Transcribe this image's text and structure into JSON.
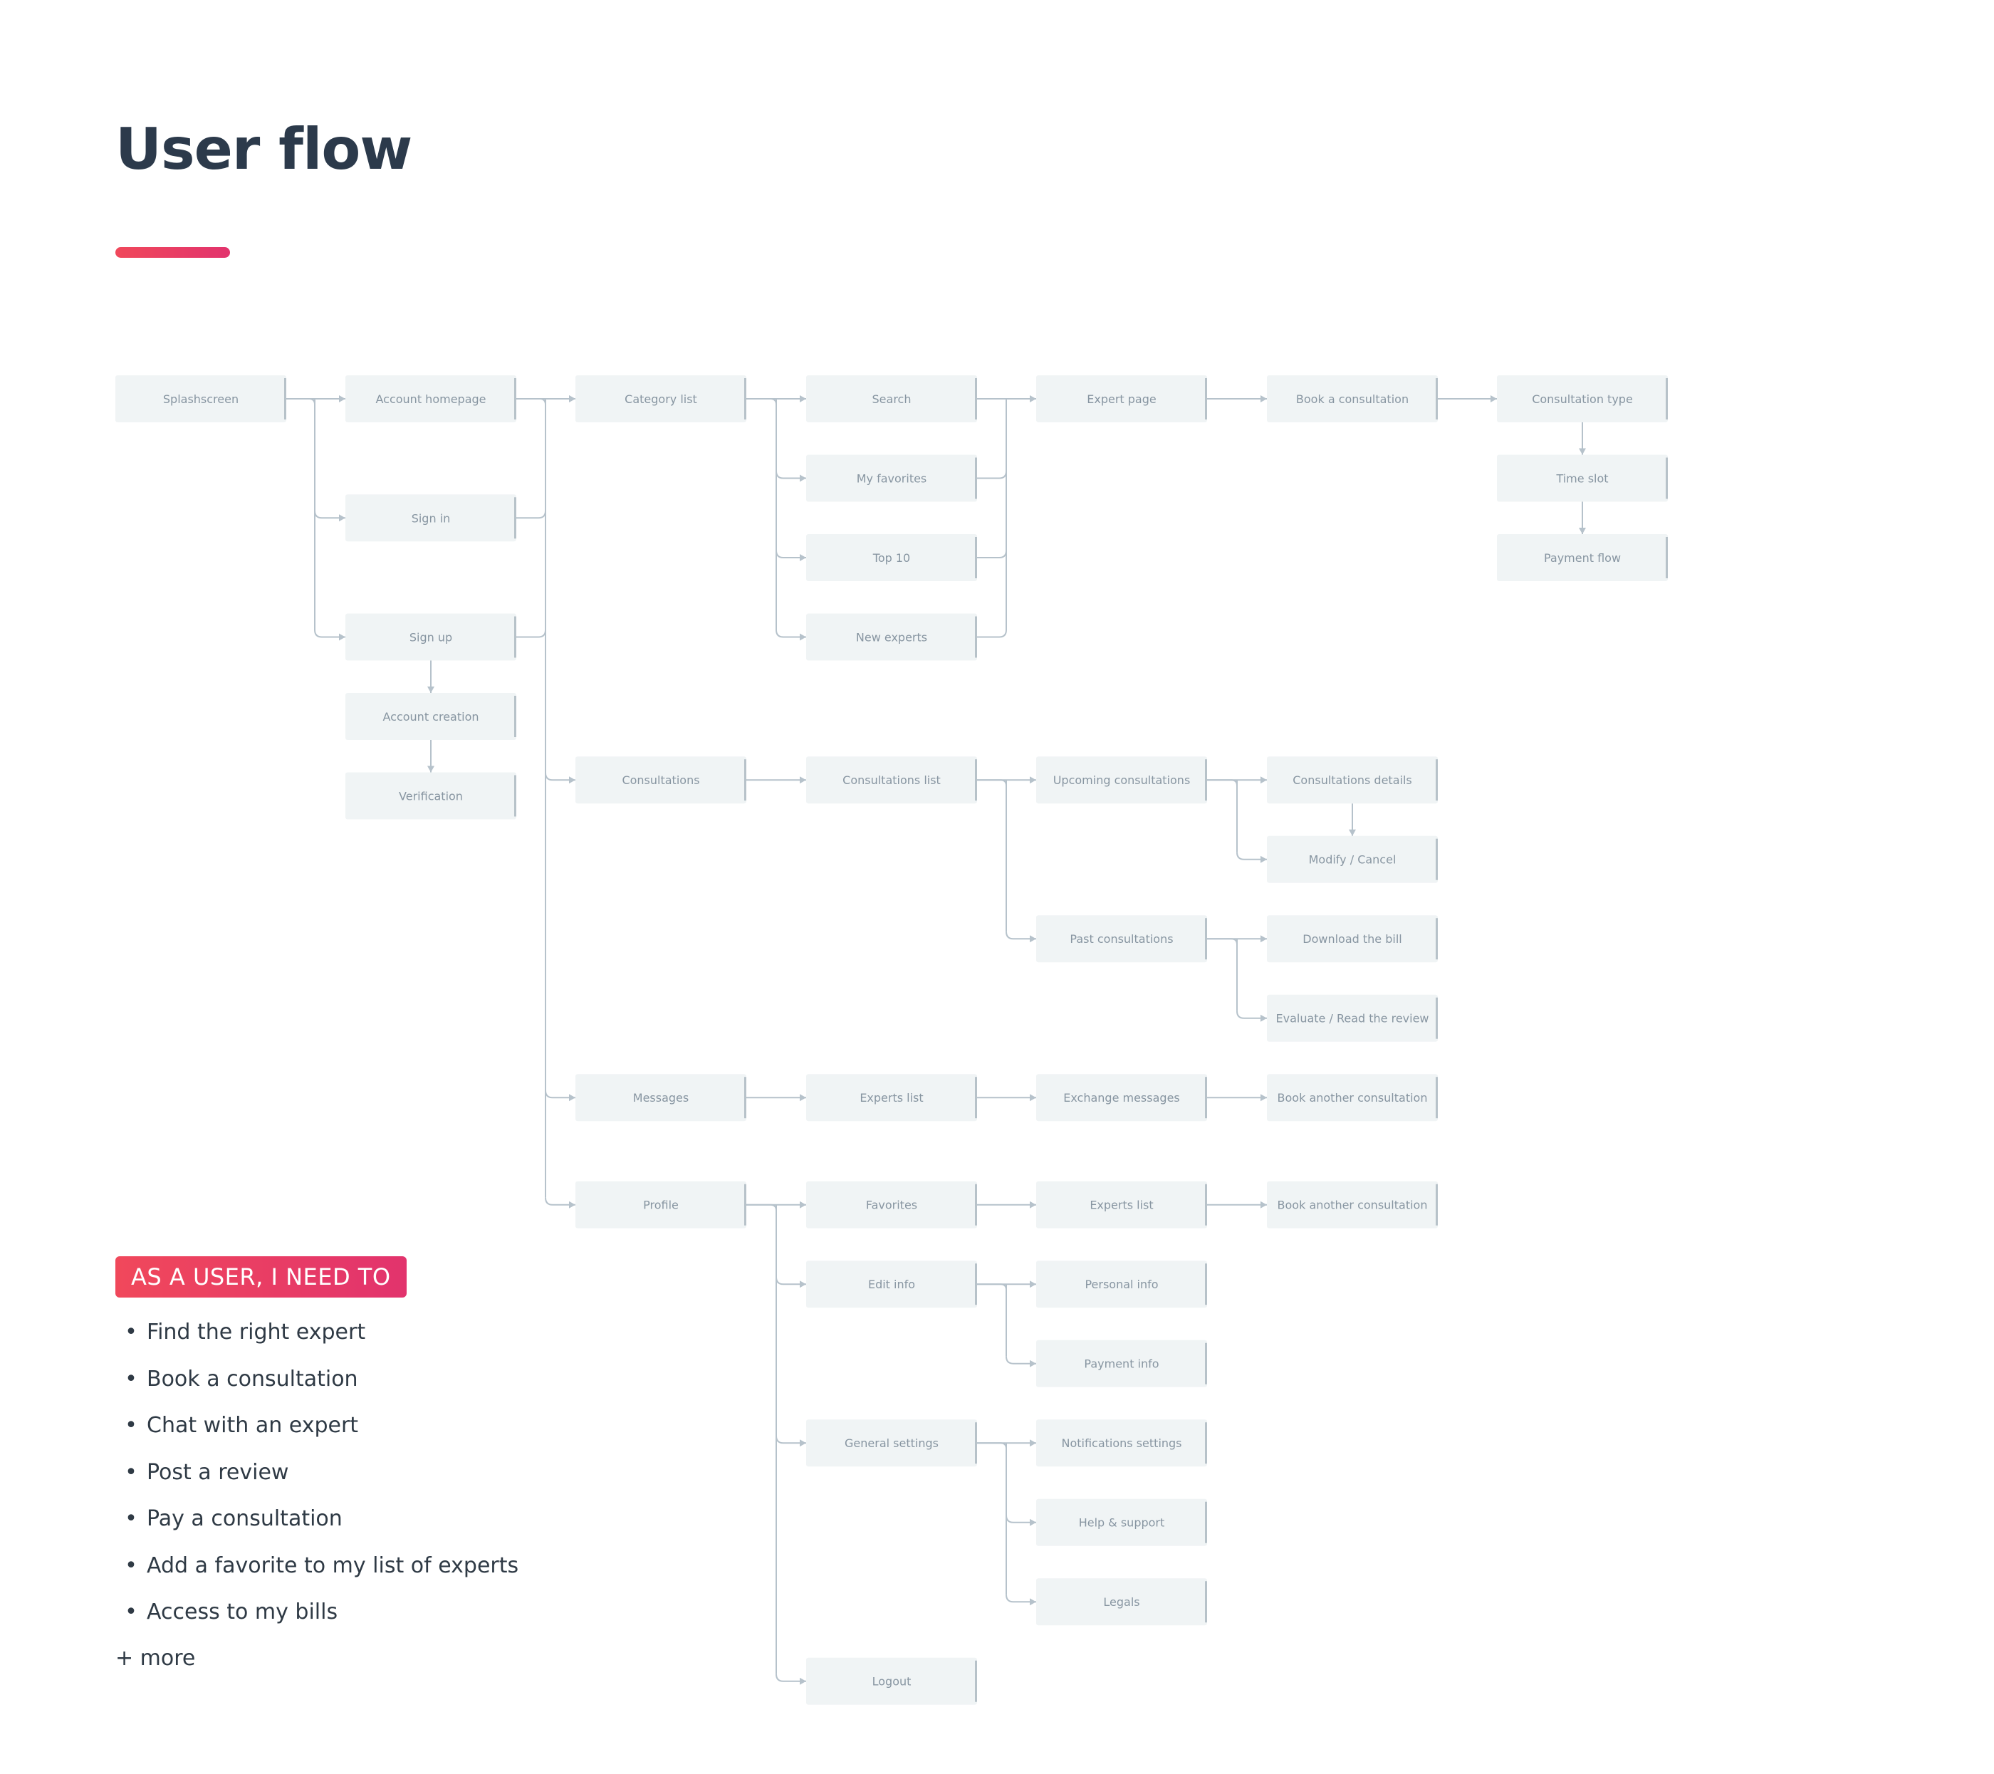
{
  "title": "User flow",
  "accent_color": "#e8405f",
  "nodes": [
    {
      "id": "splash",
      "label": "Splashscreen"
    },
    {
      "id": "account_home",
      "label": "Account homepage"
    },
    {
      "id": "sign_in",
      "label": "Sign in"
    },
    {
      "id": "sign_up",
      "label": "Sign up"
    },
    {
      "id": "account_creation",
      "label": "Account creation"
    },
    {
      "id": "verification",
      "label": "Verification"
    },
    {
      "id": "category_list",
      "label": "Category list"
    },
    {
      "id": "search",
      "label": "Search"
    },
    {
      "id": "my_favorites",
      "label": "My favorites"
    },
    {
      "id": "top10",
      "label": "Top 10"
    },
    {
      "id": "new_experts",
      "label": "New experts"
    },
    {
      "id": "expert_page",
      "label": "Expert page"
    },
    {
      "id": "book_consult",
      "label": "Book a consultation"
    },
    {
      "id": "consult_type",
      "label": "Consultation type"
    },
    {
      "id": "time_slot",
      "label": "Time slot"
    },
    {
      "id": "payment_flow",
      "label": "Payment flow"
    },
    {
      "id": "consultations",
      "label": "Consultations"
    },
    {
      "id": "consult_list",
      "label": "Consultations list"
    },
    {
      "id": "upcoming",
      "label": "Upcoming consultations"
    },
    {
      "id": "consult_details",
      "label": "Consultations details"
    },
    {
      "id": "modify_cancel",
      "label": "Modify / Cancel"
    },
    {
      "id": "past",
      "label": "Past consultations"
    },
    {
      "id": "download_bill",
      "label": "Download the bill"
    },
    {
      "id": "evaluate",
      "label": "Evaluate / Read the review"
    },
    {
      "id": "messages",
      "label": "Messages"
    },
    {
      "id": "experts_list_msg",
      "label": "Experts list"
    },
    {
      "id": "exchange_msgs",
      "label": "Exchange messages"
    },
    {
      "id": "book_another_1",
      "label": "Book another consultation"
    },
    {
      "id": "profile",
      "label": "Profile"
    },
    {
      "id": "favorites",
      "label": "Favorites"
    },
    {
      "id": "experts_list_fav",
      "label": "Experts list"
    },
    {
      "id": "book_another_2",
      "label": "Book another consultation"
    },
    {
      "id": "edit_info",
      "label": "Edit info"
    },
    {
      "id": "personal_info",
      "label": "Personal info"
    },
    {
      "id": "payment_info",
      "label": "Payment info"
    },
    {
      "id": "general_settings",
      "label": "General settings"
    },
    {
      "id": "notif_settings",
      "label": "Notifications settings"
    },
    {
      "id": "help_support",
      "label": "Help & support"
    },
    {
      "id": "legals",
      "label": "Legals"
    },
    {
      "id": "logout",
      "label": "Logout"
    }
  ],
  "needs": {
    "heading": "AS A USER, I NEED TO",
    "items": [
      "Find the right expert",
      "Book a consultation",
      "Chat with an expert",
      "Post a review",
      "Pay a consultation",
      "Add a favorite to my list of experts",
      "Access to my bills"
    ],
    "bullet": "•",
    "more": "+ more"
  }
}
